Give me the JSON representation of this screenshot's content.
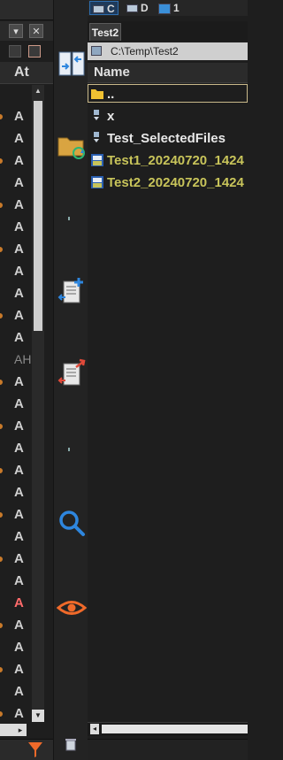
{
  "left_pane": {
    "column_header": "At",
    "rows": [
      {
        "attr": "A",
        "marker": true
      },
      {
        "attr": "A",
        "marker": false
      },
      {
        "attr": "A",
        "marker": true
      },
      {
        "attr": "A",
        "marker": false
      },
      {
        "attr": "A",
        "marker": true
      },
      {
        "attr": "A",
        "marker": false
      },
      {
        "attr": "A",
        "marker": true
      },
      {
        "attr": "A",
        "marker": false
      },
      {
        "attr": "A",
        "marker": false
      },
      {
        "attr": "A",
        "marker": true
      },
      {
        "attr": "A",
        "marker": false
      },
      {
        "attr": "AH",
        "marker": false,
        "style": "dim"
      },
      {
        "attr": "A",
        "marker": true
      },
      {
        "attr": "A",
        "marker": false
      },
      {
        "attr": "A",
        "marker": true
      },
      {
        "attr": "A",
        "marker": false
      },
      {
        "attr": "A",
        "marker": true
      },
      {
        "attr": "A",
        "marker": false
      },
      {
        "attr": "A",
        "marker": true
      },
      {
        "attr": "A",
        "marker": false
      },
      {
        "attr": "A",
        "marker": true
      },
      {
        "attr": "A",
        "marker": false
      },
      {
        "attr": "A",
        "marker": false,
        "style": "red"
      },
      {
        "attr": "A",
        "marker": true
      },
      {
        "attr": "A",
        "marker": false
      },
      {
        "attr": "A",
        "marker": true
      },
      {
        "attr": "A",
        "marker": false
      },
      {
        "attr": "A",
        "marker": true
      }
    ]
  },
  "drives": [
    {
      "label": "C",
      "active": true
    },
    {
      "label": "D",
      "active": false
    },
    {
      "label": "1",
      "active": false
    }
  ],
  "tab": {
    "label": "Test2"
  },
  "path": {
    "text": "C:\\Temp\\Test2"
  },
  "file_list": {
    "column_header": "Name",
    "items": [
      {
        "name": "..",
        "type": "parent-folder",
        "selected": true
      },
      {
        "name": "x",
        "type": "shortcut"
      },
      {
        "name": "Test_SelectedFiles",
        "type": "shortcut"
      },
      {
        "name": "Test1_20240720_1424",
        "type": "text-file"
      },
      {
        "name": "Test2_20240720_1424",
        "type": "text-file"
      }
    ]
  },
  "colors": {
    "accent_folder": "#f1c232",
    "text_file": "#c8c45a",
    "marker": "#c97a2a",
    "red_attr": "#ff6b6b",
    "sync_arrow": "#2e86de",
    "eye": "#f06a2a"
  },
  "icons": {
    "middle": [
      "compare-icon",
      "sync-folder-icon",
      "copy-add-icon",
      "move-icon",
      "search-icon",
      "view-eye-icon",
      "recycle-bin-icon"
    ],
    "filter": "filter-icon"
  }
}
